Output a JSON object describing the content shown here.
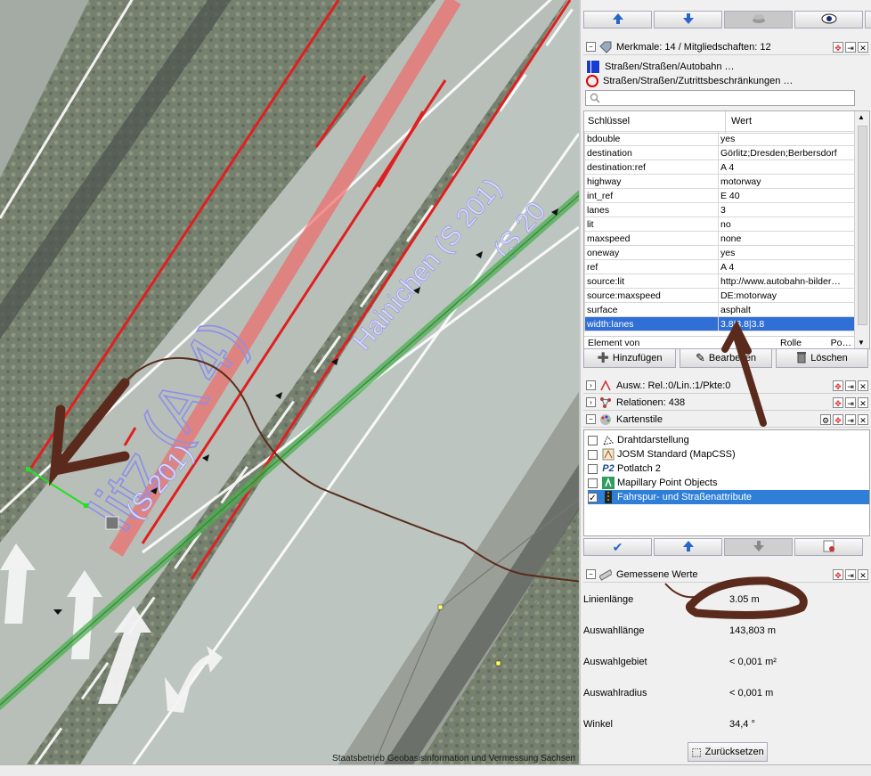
{
  "map": {
    "road_labels": [
      "litz (A 4)",
      "Hainichen (S 201)",
      "(S 201)",
      "(S 20"
    ],
    "attribution": "Staatsbetrieb Geobasisinformation und Vermessung Sachsen",
    "colors": {
      "lane_red": "#e02020",
      "way_green": "#4caf50",
      "label_blue": "#8888dd",
      "annotation_brown": "#5a2b1c"
    }
  },
  "toolbar": {
    "icons": [
      "arrow-up-icon",
      "arrow-down-icon",
      "stack-icon",
      "eye-icon",
      "trash-icon"
    ]
  },
  "tags_panel": {
    "title": "Merkmale: 14 / Mitgliedschaften: 12",
    "presets": [
      "Straßen/Straßen/Autobahn …",
      "Straßen/Straßen/Zutrittsbeschränkungen …"
    ],
    "search_placeholder": "",
    "col_key": "Schlüssel",
    "col_value": "Wert",
    "rows": [
      {
        "k": "bdouble",
        "v": "yes"
      },
      {
        "k": "destination",
        "v": "Görlitz;Dresden;Berbersdorf"
      },
      {
        "k": "destination:ref",
        "v": "A 4"
      },
      {
        "k": "highway",
        "v": "motorway"
      },
      {
        "k": "int_ref",
        "v": "E 40"
      },
      {
        "k": "lanes",
        "v": "3"
      },
      {
        "k": "lit",
        "v": "no"
      },
      {
        "k": "maxspeed",
        "v": "none"
      },
      {
        "k": "oneway",
        "v": "yes"
      },
      {
        "k": "ref",
        "v": "A 4"
      },
      {
        "k": "source:lit",
        "v": "http://www.autobahn-bilder…"
      },
      {
        "k": "source:maxspeed",
        "v": "DE:motorway"
      },
      {
        "k": "surface",
        "v": "asphalt"
      },
      {
        "k": "width:lanes",
        "v": "3.8|3.8|3.8"
      }
    ],
    "membership_cols": [
      "Element von",
      "Rolle",
      "Po…"
    ],
    "btn_add": "Hinzufügen",
    "btn_edit": "Bearbeiten",
    "btn_delete": "Löschen"
  },
  "selection_panel": {
    "title": "Ausw.: Rel.:0/Lin.:1/Pkte:0"
  },
  "relations_panel": {
    "title": "Relationen: 438"
  },
  "mapstyles_panel": {
    "title": "Kartenstile",
    "items": [
      {
        "label": "Drahtdarstellung",
        "checked": false
      },
      {
        "label": "JOSM Standard (MapCSS)",
        "checked": false
      },
      {
        "label": "Potlatch 2",
        "checked": false
      },
      {
        "label": "Mapillary Point Objects",
        "checked": false
      },
      {
        "label": "Fahrspur- und Straßenattribute",
        "checked": true
      }
    ]
  },
  "measurement_panel": {
    "title": "Gemessene Werte",
    "rows": [
      {
        "label": "Linienlänge",
        "value": "3.05 m"
      },
      {
        "label": "Auswahllänge",
        "value": "143,803 m"
      },
      {
        "label": "Auswahlgebiet",
        "value": "< 0,001 m²"
      },
      {
        "label": "Auswahlradius",
        "value": "< 0,001 m"
      },
      {
        "label": "Winkel",
        "value": "34,4 °"
      }
    ],
    "reset": "Zurücksetzen"
  }
}
